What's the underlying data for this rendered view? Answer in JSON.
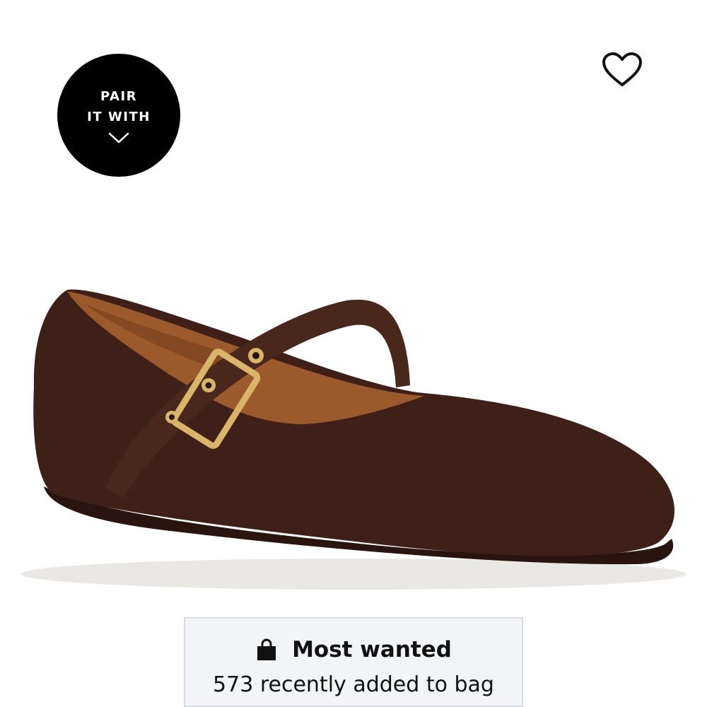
{
  "pair_it_with": {
    "line1": "PAIR",
    "line2": "IT WITH",
    "icon": "chevron-down-icon"
  },
  "wishlist": {
    "icon": "heart-outline-icon"
  },
  "product": {
    "color_hex": "#3e2018",
    "lining_hex": "#9c5a2c",
    "hardware_hex": "#d9b46a"
  },
  "badge": {
    "icon": "shopping-bag-icon",
    "title": "Most wanted",
    "subtitle": "573 recently added to bag"
  }
}
